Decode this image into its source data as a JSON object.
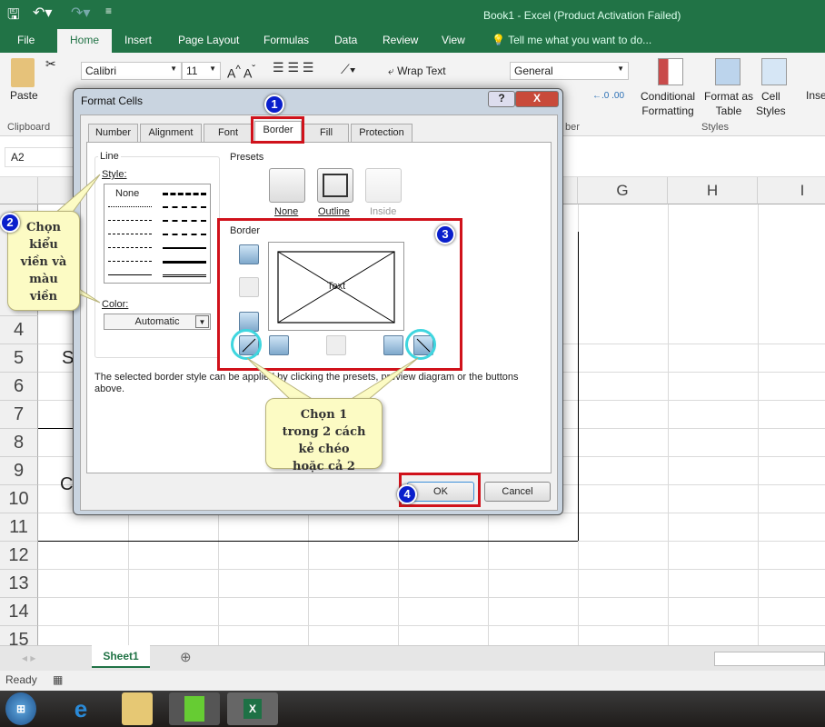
{
  "window": {
    "title": "Book1 - Excel (Product Activation Failed)"
  },
  "qat": {
    "save": "save-icon",
    "undo": "undo-icon",
    "redo": "redo-icon"
  },
  "ribbon_tabs": [
    "File",
    "Home",
    "Insert",
    "Page Layout",
    "Formulas",
    "Data",
    "Review",
    "View"
  ],
  "tell_me": "Tell me what you want to do...",
  "ribbon": {
    "paste": "Paste",
    "clipboard": "Clipboard",
    "font_name": "Calibri",
    "font_size": "11",
    "wrap_text": "Wrap Text",
    "number_format": "General",
    "number_group": "ber",
    "conditional_formatting": [
      "Conditional",
      "Formatting"
    ],
    "format_as_table": [
      "Format as",
      "Table"
    ],
    "cell_styles": [
      "Cell",
      "Styles"
    ],
    "styles_group": "Styles",
    "insert": "Inse"
  },
  "name_box": "A2",
  "columns": [
    "G",
    "H",
    "I"
  ],
  "rows": [
    "4",
    "5",
    "6",
    "7",
    "8",
    "9",
    "10",
    "11",
    "12",
    "13",
    "14",
    "15"
  ],
  "cell_fragments": {
    "a5": "S",
    "a10": "C"
  },
  "sheet_tabs": [
    "Sheet1"
  ],
  "status": "Ready",
  "dialog": {
    "title": "Format Cells",
    "help": "?",
    "close": "X",
    "tabs": [
      "Number",
      "Alignment",
      "Font",
      "Border",
      "Fill",
      "Protection"
    ],
    "active_tab": "Border",
    "line_label": "Line",
    "style_label": "Style:",
    "style_none": "None",
    "color_label": "Color:",
    "color_value": "Automatic",
    "presets_label": "Presets",
    "presets": [
      "None",
      "Outline",
      "Inside"
    ],
    "border_label": "Border",
    "preview_text": "Text",
    "hint": "The selected border style can be applied by clicking the presets, preview diagram or the buttons above.",
    "ok": "OK",
    "cancel": "Cancel"
  },
  "annotations": {
    "step1": "1",
    "step2": "2",
    "step3": "3",
    "step4": "4",
    "callout_style": "Chọn kiểu viền và màu viền",
    "callout_diagonal": "Chọn 1 trong 2 cách kẻ chéo hoặc cả 2",
    "highlight_color": "#d0121b",
    "ring_color": "#3fd6df"
  },
  "taskbar": [
    "start-icon",
    "internet-explorer-icon",
    "file-explorer-icon",
    "notepad-plus-plus-icon",
    "excel-icon"
  ]
}
